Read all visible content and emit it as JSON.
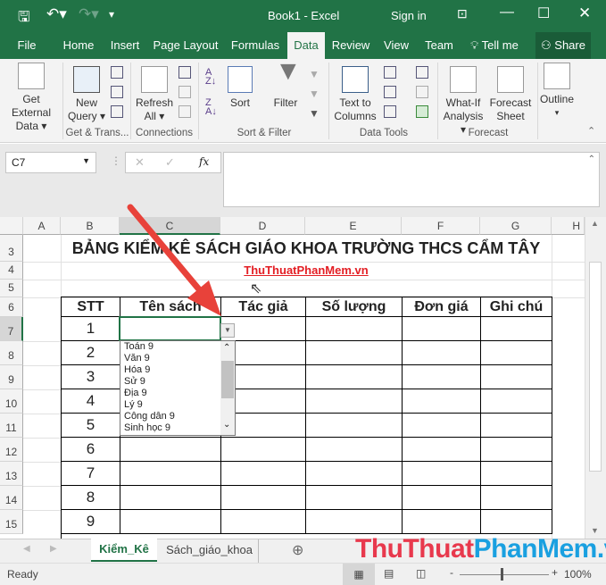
{
  "titlebar": {
    "title": "Book1  -  Excel",
    "sign_in": "Sign in"
  },
  "tabs": [
    "File",
    "Home",
    "Insert",
    "Page Layout",
    "Formulas",
    "Data",
    "Review",
    "View",
    "Team",
    "Tell me",
    "Share"
  ],
  "ribbon": {
    "get_external": "Get External",
    "get_external2": "Data ▾",
    "new_query": "New",
    "new_query2": "Query ▾",
    "refresh": "Refresh",
    "refresh2": "All ▾",
    "sort": "Sort",
    "filter": "Filter",
    "text_to": "Text to",
    "columns": "Columns",
    "whatif": "What-If",
    "analysis": "Analysis ▾",
    "forecast": "Forecast",
    "sheet": "Sheet",
    "outline": "Outline",
    "groups": [
      "Get & Trans...",
      "Connections",
      "Sort & Filter",
      "Data Tools",
      "Forecast"
    ]
  },
  "formula_bar": {
    "name_box": "C7",
    "fx": "fx",
    "value": ""
  },
  "columns": [
    "A",
    "B",
    "C",
    "D",
    "E",
    "F",
    "G",
    "H"
  ],
  "rows": [
    "3",
    "4",
    "5",
    "6",
    "7",
    "8",
    "9",
    "10",
    "11",
    "12",
    "13",
    "14",
    "15"
  ],
  "sheet": {
    "title": "BẢNG KIỂM KÊ SÁCH GIÁO KHOA TRƯỜNG THCS CẨM TÂY",
    "link": "ThuThuatPhanMem.vn",
    "headers": [
      "STT",
      "Tên sách",
      "Tác giả",
      "Số lượng",
      "Đơn giá",
      "Ghi chú"
    ],
    "stt": [
      "1",
      "2",
      "3",
      "4",
      "5",
      "6",
      "7",
      "8",
      "9"
    ]
  },
  "dropdown": [
    "Toán 9",
    "Văn 9",
    "Hóa 9",
    "Sử 9",
    "Địa 9",
    "Lý 9",
    "Công dân 9",
    "Sinh học 9"
  ],
  "sheet_tabs": [
    "Kiểm_Kê",
    "Sách_giáo_khoa"
  ],
  "watermark": {
    "part1": "ThuThuat",
    "part2": "PhanMem.vn"
  },
  "status": {
    "ready": "Ready",
    "zoom": "100%"
  }
}
